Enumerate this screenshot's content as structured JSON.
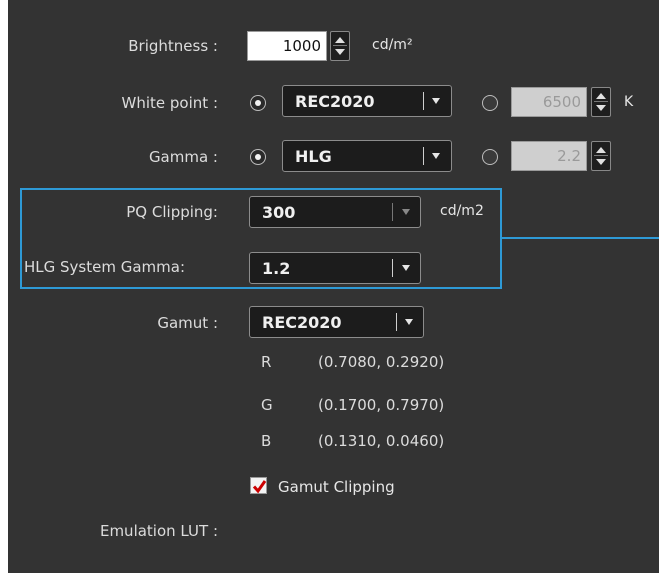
{
  "brightness": {
    "label": "Brightness :",
    "value": "1000",
    "unit": "cd/m²"
  },
  "white_point": {
    "label": "White point :",
    "preset": "REC2020",
    "custom_value": "6500",
    "unit": "K",
    "selected": "preset"
  },
  "gamma": {
    "label": "Gamma :",
    "preset": "HLG",
    "custom_value": "2.2",
    "selected": "preset"
  },
  "pq_clipping": {
    "label": "PQ Clipping:",
    "value": "300",
    "unit": "cd/m2"
  },
  "hlg_system_gamma": {
    "label": "HLG System Gamma:",
    "value": "1.2"
  },
  "gamut": {
    "label": "Gamut :",
    "value": "REC2020",
    "primaries": [
      {
        "channel": "R",
        "coords": "(0.7080, 0.2920)"
      },
      {
        "channel": "G",
        "coords": "(0.1700, 0.7970)"
      },
      {
        "channel": "B",
        "coords": "(0.1310, 0.0460)"
      }
    ],
    "clipping_label": "Gamut Clipping",
    "clipping_checked": true
  },
  "emulation_lut": {
    "label": "Emulation LUT :"
  },
  "colors": {
    "highlight": "#2e9ad6",
    "panel": "#333333",
    "check": "#cc0000"
  }
}
